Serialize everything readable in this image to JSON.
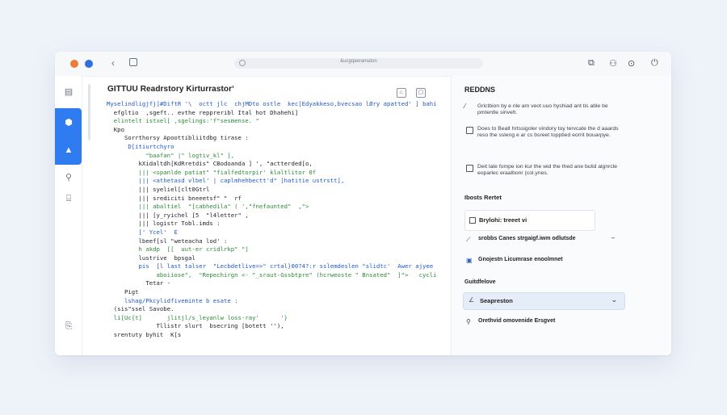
{
  "chrome": {
    "url": "&ucgqaeramaton",
    "left_icons": [
      "circle-orange",
      "circle-blue",
      "back-chevron",
      "tab-square"
    ],
    "right_icons": [
      "extensions-icon",
      "person-icon",
      "settings-icon",
      "power-icon"
    ]
  },
  "editor": {
    "title": "GITTUU Readrstory Kirturrastor‘",
    "lines": [
      "Myselindligjfj]#DiftR '\\  octt jlc  chjMDto ostle  kec[Edyakkeso,bvecsao lØry apatted' ] bahitd",
      "  efgltio  ,sgeft.. evthe reppreribl Ital hot Dhahehi]",
      "  elintelt istxel[ ,sgelings:'f\"sesmense. \"",
      "  Kpo",
      "     Sorrthorsy Apoottibliitdbg tirase :",
      "      D[itiurtchyro",
      "           \"baafan\" |\" logtiv_kl\" ],",
      "         kXidaltdh[KdRretdis\" CBodoanda ] ', \"actterded[o,",
      "         ||| <spanlde patiat\" \"fialfedtorpir' klaltlitor 0f",
      "         ||| <athetasd vlbel' | caplmhehbectt'd\" [hatitie ustrstt],",
      "         ||| syeliel[clt0Gtrl",
      "         ||| srediciti bneeetsf\" \"  rf",
      "         ||| abaltiel  \"[cabhedila\" ( ',\"fnefaunted\"  ,\">",
      "         ||| [y_ryichel [5  \"l4letter\" ,",
      "         ||| logistr Tobl.imds :",
      "         [' Ycel'  E",
      "         lbeef[sl \"weteacha lod' :",
      "         h akdp  [[  uut-er cridlrkp\" \"]",
      "         lustrive  bpsgal",
      "         pis  [l last talser  \"Lecbdetlive=>\" crtal}00?4?:r sslemdeslen \"slidtc'  Awer ajyee of tod.)",
      "              aboiiose\",  \"Repechirgn <- \"_sraut-Gssbtpre\" (hcrweoste \" Bnsated\"  ]\">   cyclitle   rsle",
      "           Tetar -",
      "     Pigt",
      "     lshag/Pkcylidfiveminte b esate :",
      "  (sis\"ssel Savobe.",
      "  li[Uc{t]       jlitjl/s_leyanlw loss-ray'      '}",
      "              Tllistr slurt  bsecring [botett ''),",
      "  srentuty byhit  K[s"
    ]
  },
  "panel": {
    "title": "REDDNS",
    "items": [
      "Grictbion by e nle am veot uuo hyshiad ant tis able be pmtentle sinvelt.",
      "Does to Bealt hrtssigoler vindory toy tervcate the d aaards reso the ssleng e ar cs bsreet topptied eorrit bouarpye.",
      "Deit late fompe ion kur the wid the thed ane bulid algnrcle eoparlec eraalbonr (col.ynes."
    ],
    "section1": "Ibosts Rertet",
    "box_label": "Brylohi: treeet  vi",
    "rows": [
      {
        "icon": "pen-icon",
        "label": "srobbs Canes strgaigf.iwm odlutsde"
      },
      {
        "icon": "image-icon",
        "label": "Gnojestn Licumrase enoolmnet"
      }
    ],
    "section2": "Guitdfelove",
    "dropdown_label": "Seapreston",
    "last_item": "Orethvid omovenide Ersgvet"
  }
}
